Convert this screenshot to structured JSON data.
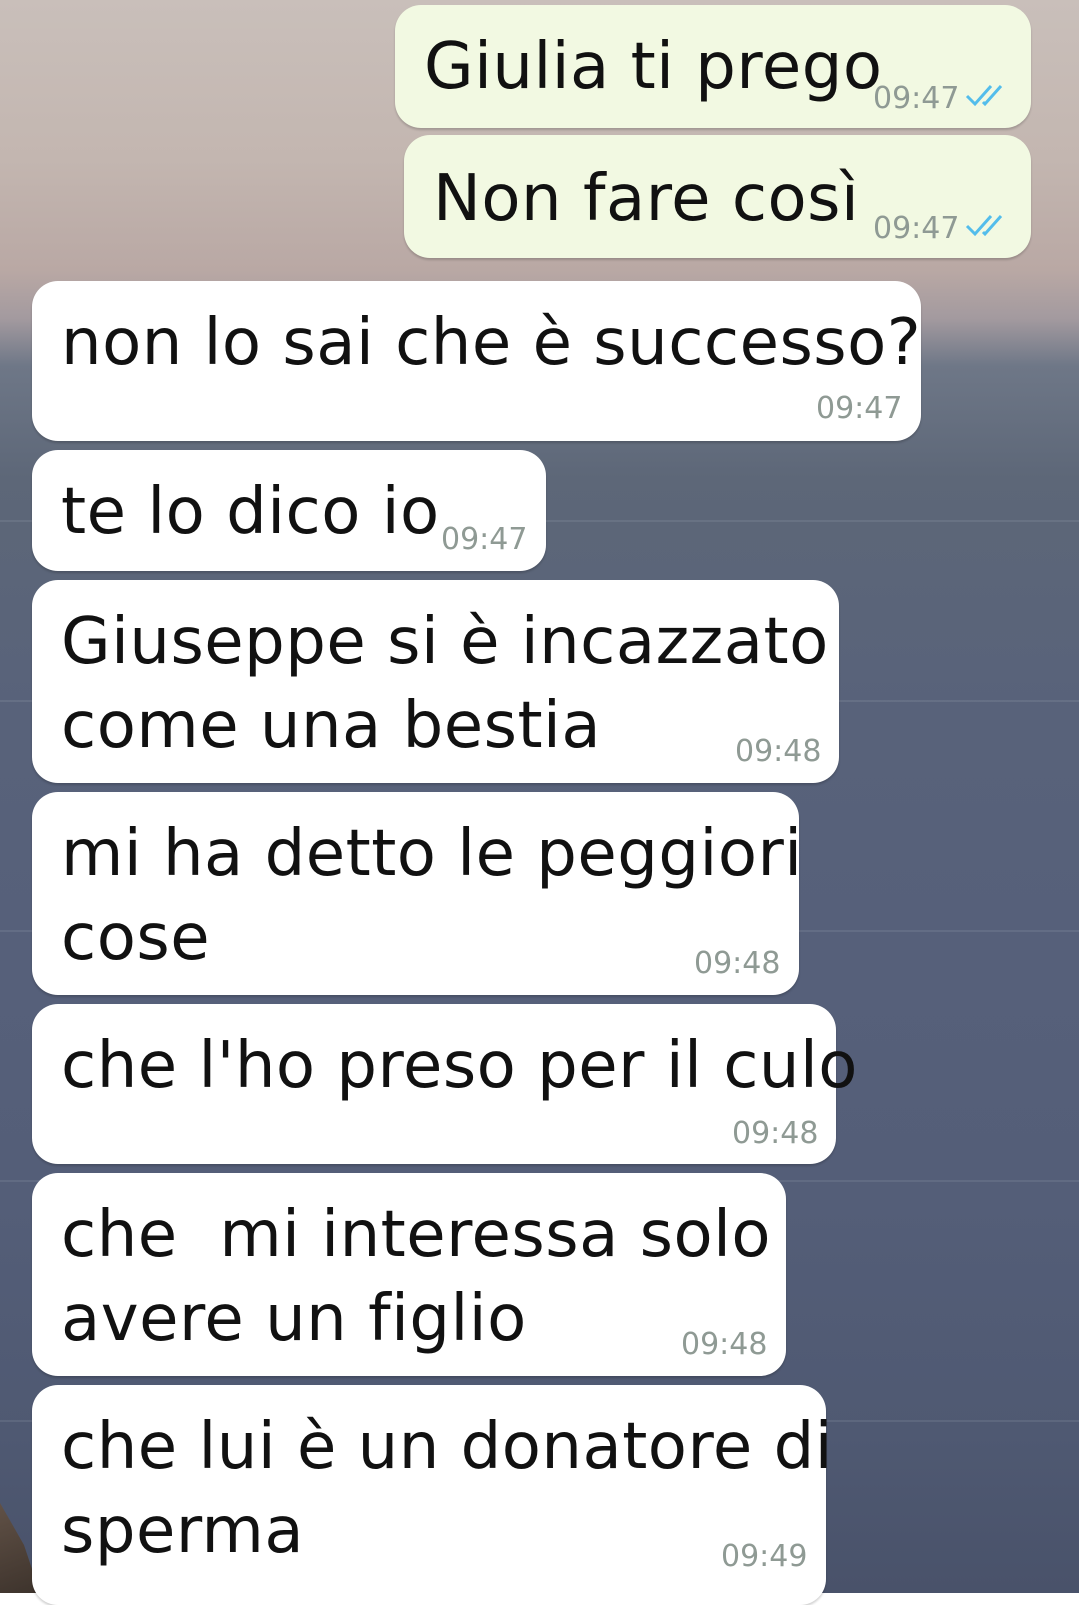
{
  "colors": {
    "outgoing_bubble": "#f2f9e2",
    "incoming_bubble": "#ffffff",
    "timestamp": "#8f9a94",
    "read_ticks": "#53bdeb"
  },
  "messages": [
    {
      "direction": "outgoing",
      "text": "Giulia ti prego",
      "time": "09:47",
      "status": "read"
    },
    {
      "direction": "outgoing",
      "text": "Non fare così",
      "time": "09:47",
      "status": "read"
    },
    {
      "direction": "incoming",
      "text": "non lo sai che è successo?",
      "time": "09:47"
    },
    {
      "direction": "incoming",
      "text": "te lo dico io",
      "time": "09:47"
    },
    {
      "direction": "incoming",
      "text": "Giuseppe si è incazzato\ncome una bestia",
      "time": "09:48"
    },
    {
      "direction": "incoming",
      "text": "mi ha detto le peggiori\ncose",
      "time": "09:48"
    },
    {
      "direction": "incoming",
      "text": "che l'ho preso per il culo",
      "time": "09:48"
    },
    {
      "direction": "incoming",
      "text": "che  mi interessa solo\navere un figlio",
      "time": "09:48"
    },
    {
      "direction": "incoming",
      "text": "che lui è un donatore di\nsperma",
      "time": "09:49"
    }
  ]
}
